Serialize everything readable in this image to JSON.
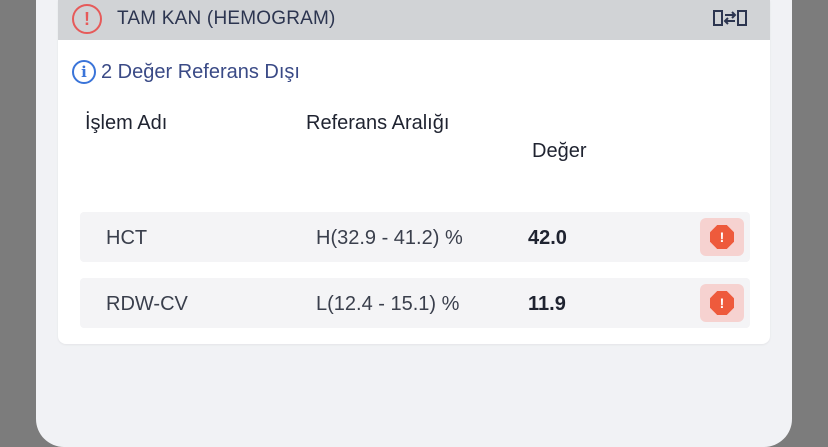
{
  "panel": {
    "title": "TAM KAN (HEMOGRAM)",
    "alert_glyph": "!",
    "info_glyph": "i",
    "info_text": "2 Değer Referans Dışı"
  },
  "table": {
    "headers": {
      "name": "İşlem Adı",
      "range": "Referans Aralığı",
      "value": "Değer"
    },
    "rows": [
      {
        "name": "HCT",
        "range": "H(32.9 - 41.2) %",
        "value": "42.0",
        "badge": "!"
      },
      {
        "name": "RDW-CV",
        "range": "L(12.4 - 15.1) %",
        "value": "11.9",
        "badge": "!"
      }
    ]
  },
  "colors": {
    "alert": "#e65a5a",
    "info": "#3a74d9",
    "badge": "#ee5a3c",
    "header_bg": "#d1d3d6"
  },
  "icons": {
    "header_alert": "alert-circle-icon",
    "header_swap": "swap-icon",
    "info": "info-circle-icon",
    "row_badge": "warning-octagon-icon"
  }
}
